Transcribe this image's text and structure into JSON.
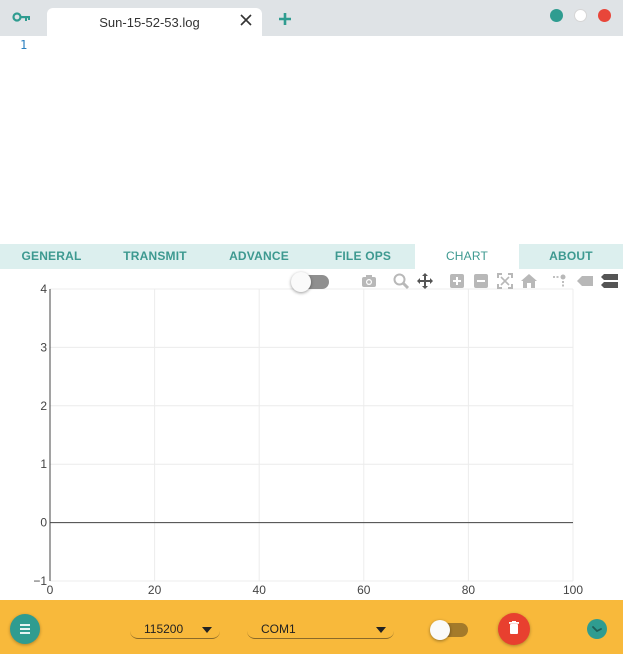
{
  "titlebar": {
    "tab_title": "Sun-15-52-53.log",
    "icons": [
      "key-icon",
      "close-icon",
      "plus-icon"
    ],
    "window_controls": [
      "minimize-dot",
      "maximize-dot",
      "close-dot"
    ]
  },
  "editor": {
    "line_number": "1"
  },
  "nav": {
    "tabs": [
      {
        "label": "GENERAL"
      },
      {
        "label": "TRANSMIT"
      },
      {
        "label": "ADVANCE"
      },
      {
        "label": "FILE OPS"
      },
      {
        "label": "CHART"
      },
      {
        "label": "ABOUT"
      }
    ],
    "active": "CHART"
  },
  "chart_toolbar": {
    "toggle_on": false,
    "icons": [
      "camera-icon",
      "zoom-icon",
      "pan-icon",
      "zoom-in-icon",
      "zoom-out-icon",
      "autoscale-icon",
      "home-icon",
      "spike-lines-icon",
      "hover-closest-icon",
      "hover-compare-icon"
    ]
  },
  "chart_data": {
    "type": "line",
    "series": [],
    "xlim": [
      0,
      100
    ],
    "ylim": [
      -1,
      4
    ],
    "xticks": [
      "0",
      "20",
      "40",
      "60",
      "80",
      "100"
    ],
    "yticks": [
      "−1",
      "0",
      "1",
      "2",
      "3",
      "4"
    ],
    "grid": true,
    "zero_line": true
  },
  "bottombar": {
    "baud_rate": "115200",
    "port": "COM1",
    "toggle_on": false,
    "icons": [
      "menu-icon",
      "trash-icon",
      "link-icon"
    ],
    "colors": {
      "bar": "#f8b93b",
      "accent": "#2f9c90",
      "danger": "#e8402f"
    }
  }
}
